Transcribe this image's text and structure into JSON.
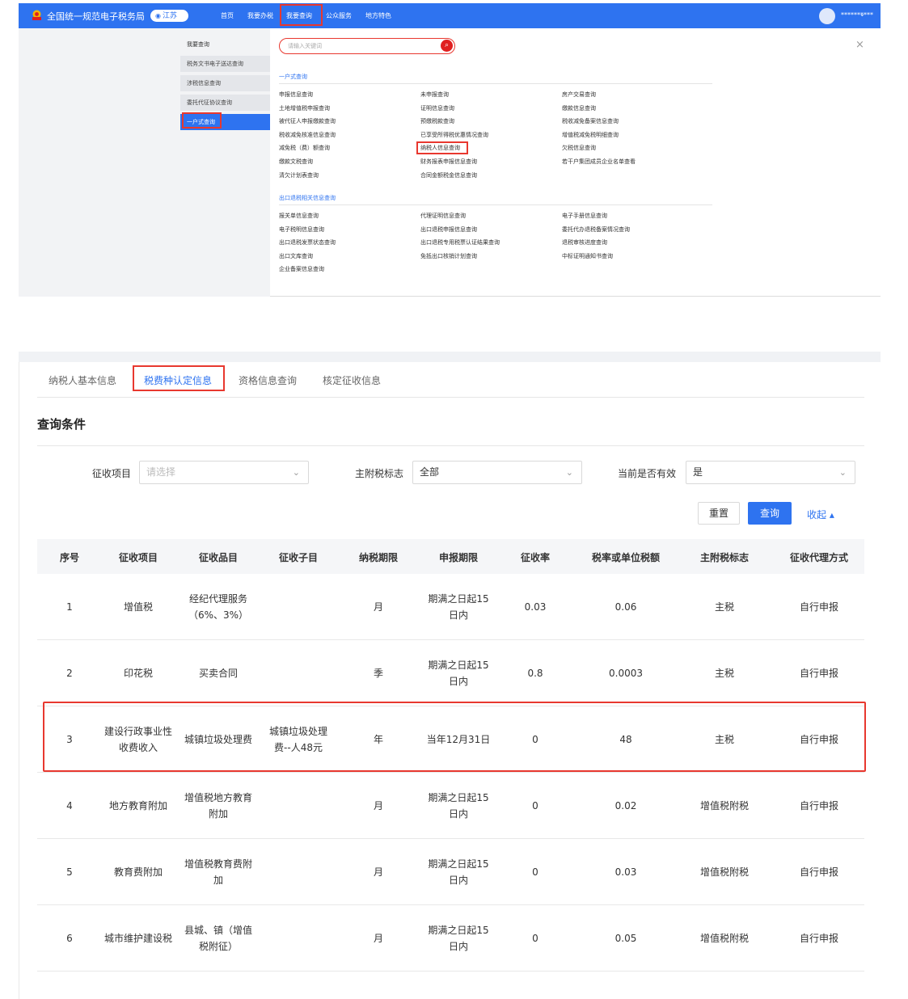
{
  "nav": {
    "site_title": "全国统一规范电子税务局",
    "region": "江苏",
    "items": [
      "首页",
      "我要办税",
      "我要查询",
      "公众服务",
      "地方特色"
    ],
    "user": "**********"
  },
  "sidebar": {
    "title": "我要查询",
    "items": [
      "税务文书电子送达查询",
      "涉税信息查询",
      "委托代征协议查询",
      "一户式查询"
    ]
  },
  "search": {
    "placeholder": "请输入关键词"
  },
  "section1": {
    "title": "一户式查询",
    "links": [
      [
        "申报信息查询",
        "未申报查询",
        "房产交易查询"
      ],
      [
        "土地增值税申报查询",
        "证明信息查询",
        "缴款信息查询"
      ],
      [
        "被代征人申报缴款查询",
        "预缴税款查询",
        "税收减免备案信息查询"
      ],
      [
        "税收减免核准信息查询",
        "已享受所得税优惠情况查询",
        "增值税减免税明细查询"
      ],
      [
        "减免税（费）额查询",
        "纳税人信息查询",
        "欠税信息查询"
      ],
      [
        "缴款文税查询",
        "财务报表申报信息查询",
        "若干户集团成员企业名单查看"
      ],
      [
        "清欠计划表查询",
        "合同金额税金信息查询",
        ""
      ]
    ]
  },
  "section2": {
    "title": "出口退税相关信息查询",
    "links": [
      [
        "报关单信息查询",
        "代理证明信息查询",
        "电子手册信息查询"
      ],
      [
        "电子税明信息查询",
        "出口退税申报信息查询",
        "委托代办退税备案情况查询"
      ],
      [
        "出口退税发票状态查询",
        "出口退税专用税票认证结果查询",
        "退税审核进度查询"
      ],
      [
        "出口文库查询",
        "免抵出口核销计划查询",
        "中标证明通知书查询"
      ],
      [
        "企业备案信息查询",
        "",
        ""
      ]
    ]
  },
  "tabs": [
    "纳税人基本信息",
    "税费种认定信息",
    "资格信息查询",
    "核定征收信息"
  ],
  "query": {
    "title": "查询条件",
    "fields": [
      {
        "label": "征收项目",
        "value": "请选择"
      },
      {
        "label": "主附税标志",
        "value": "全部"
      },
      {
        "label": "当前是否有效",
        "value": "是"
      }
    ],
    "reset": "重置",
    "submit": "查询",
    "collapse": "收起 ▴"
  },
  "table": {
    "headers": [
      "序号",
      "征收项目",
      "征收品目",
      "征收子目",
      "纳税期限",
      "申报期限",
      "征收率",
      "税率或单位税额",
      "主附税标志",
      "征收代理方式"
    ],
    "rows": [
      [
        "1",
        "增值税",
        "经纪代理服务（6%、3%）",
        "",
        "月",
        "期满之日起15日内",
        "0.03",
        "0.06",
        "主税",
        "自行申报"
      ],
      [
        "2",
        "印花税",
        "买卖合同",
        "",
        "季",
        "期满之日起15日内",
        "0.8",
        "0.0003",
        "主税",
        "自行申报"
      ],
      [
        "3",
        "建设行政事业性收费收入",
        "城镇垃圾处理费",
        "城镇垃圾处理费--人48元",
        "年",
        "当年12月31日",
        "0",
        "48",
        "主税",
        "自行申报"
      ],
      [
        "4",
        "地方教育附加",
        "增值税地方教育附加",
        "",
        "月",
        "期满之日起15日内",
        "0",
        "0.02",
        "增值税附税",
        "自行申报"
      ],
      [
        "5",
        "教育费附加",
        "增值税教育费附加",
        "",
        "月",
        "期满之日起15日内",
        "0",
        "0.03",
        "增值税附税",
        "自行申报"
      ],
      [
        "6",
        "城市维护建设税",
        "县城、镇（增值税附征）",
        "",
        "月",
        "期满之日起15日内",
        "0",
        "0.05",
        "增值税附税",
        "自行申报"
      ]
    ]
  },
  "colors": {
    "primary": "#2e73f0",
    "highlight": "#e8382f"
  }
}
